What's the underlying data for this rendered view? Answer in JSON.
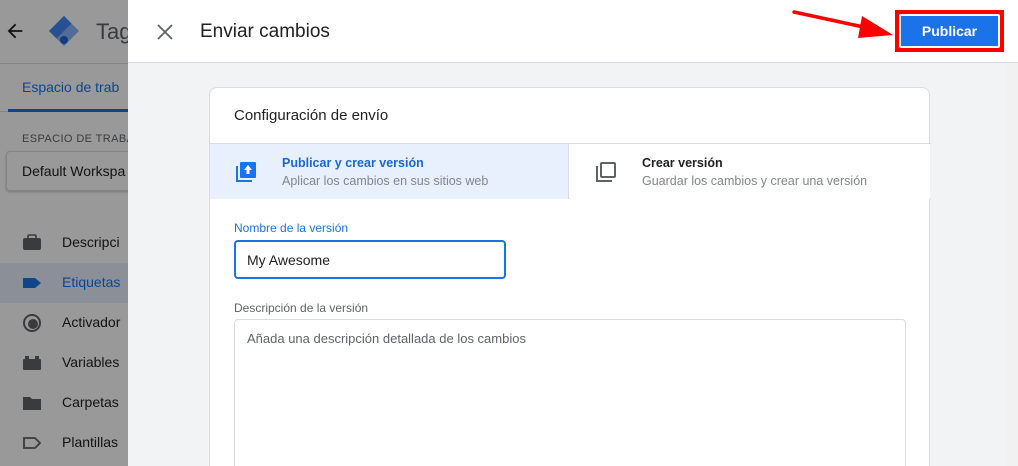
{
  "background_app": {
    "title": "Tag",
    "tab_label": "Espacio de trab",
    "workspace_label": "ESPACIO DE TRABA",
    "workspace_value": "Default Workspa",
    "nav_items": [
      {
        "label": "Descripci",
        "icon": "briefcase-icon"
      },
      {
        "label": "Etiquetas",
        "icon": "tag-icon"
      },
      {
        "label": "Activador",
        "icon": "trigger-icon"
      },
      {
        "label": "Variables",
        "icon": "blocks-icon"
      },
      {
        "label": "Carpetas",
        "icon": "folder-icon"
      },
      {
        "label": "Plantillas",
        "icon": "template-tag-icon"
      }
    ],
    "active_nav_index": 1
  },
  "panel": {
    "title": "Enviar cambios",
    "publish_label": "Publicar",
    "highlight_color": "#ff0000"
  },
  "config": {
    "title": "Configuración de envío",
    "options": [
      {
        "title": "Publicar y crear versión",
        "subtitle": "Aplicar los cambios en sus sitios web",
        "icon": "publish-upload-icon",
        "selected": true
      },
      {
        "title": "Crear versión",
        "subtitle": "Guardar los cambios y crear una versión",
        "icon": "copy-version-icon",
        "selected": false
      }
    ],
    "version_name_label": "Nombre de la versión",
    "version_name_value": "My Awesome",
    "version_desc_label": "Descripción de la versión",
    "version_desc_placeholder": "Añada una descripción detallada de los cambios"
  },
  "colors": {
    "accent": "#1a73e8",
    "selected_bg": "#e8f0fe",
    "panel_bg": "#f1f3f4"
  }
}
